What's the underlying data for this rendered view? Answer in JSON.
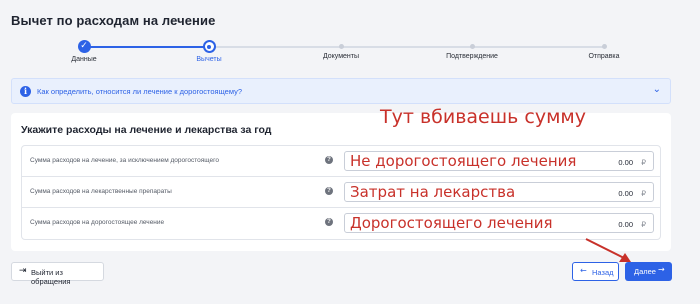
{
  "page": {
    "title": "Вычет по расходам на лечение"
  },
  "stepper": {
    "steps": [
      {
        "label": "Данные",
        "state": "done"
      },
      {
        "label": "Вычеты",
        "state": "active"
      },
      {
        "label": "Документы",
        "state": "todo"
      },
      {
        "label": "Подтверждение",
        "state": "todo"
      },
      {
        "label": "Отправка",
        "state": "todo"
      }
    ],
    "done_icon": "✓"
  },
  "info": {
    "icon": "info-icon",
    "icon_glyph": "i",
    "text": "Как определить, относится ли лечение к дорогостоящему?",
    "chevron": "⌄"
  },
  "expenses": {
    "title": "Укажите расходы на лечение и лекарства за год",
    "help_glyph": "?",
    "rows": [
      {
        "label": "Сумма расходов на лечение, за исключением дорогостоящего",
        "value": "0.00",
        "currency": "₽",
        "hint": "Не дорогостоящего лечения"
      },
      {
        "label": "Сумма расходов на лекарственные препараты",
        "value": "0.00",
        "currency": "₽",
        "hint": "Затрат на лекарства"
      },
      {
        "label": "Сумма расходов на дорогостоящее лечение",
        "value": "0.00",
        "currency": "₽",
        "hint": "Дорогостоящего лечения"
      }
    ]
  },
  "annotation": {
    "text": "Тут вбиваешь сумму",
    "color": "#c8312a"
  },
  "actions": {
    "exit": {
      "label": "Выйти из обращения",
      "icon": "⇥"
    },
    "back": {
      "label": "Назад",
      "icon": "←"
    },
    "next": {
      "label": "Далее",
      "icon": "→"
    }
  },
  "colors": {
    "accent": "#2d62e6",
    "annotation": "#c8312a",
    "background": "#f3f4f7"
  }
}
